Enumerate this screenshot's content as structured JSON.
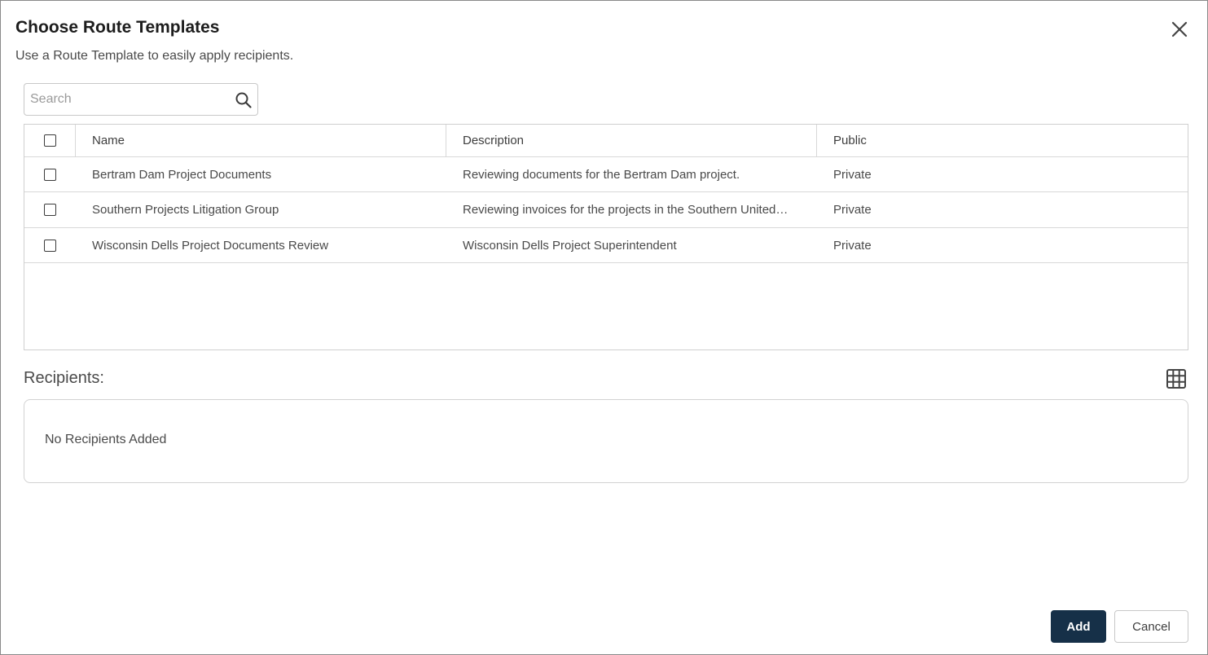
{
  "dialog": {
    "title": "Choose Route Templates",
    "subtitle": "Use a Route Template to easily apply recipients.",
    "close_icon": "close-icon"
  },
  "search": {
    "placeholder": "Search",
    "value": "",
    "icon": "search-icon"
  },
  "table": {
    "columns": [
      "Name",
      "Description",
      "Public"
    ],
    "rows": [
      {
        "name": "Bertram Dam Project Documents",
        "description": "Reviewing documents for the Bertram Dam project.",
        "public": "Private",
        "checked": false
      },
      {
        "name": "Southern Projects Litigation Group",
        "description": "Reviewing invoices for the projects in the Southern United…",
        "public": "Private",
        "checked": false
      },
      {
        "name": "Wisconsin Dells Project Documents Review",
        "description": "Wisconsin Dells Project Superintendent",
        "public": "Private",
        "checked": false
      }
    ]
  },
  "recipients": {
    "label": "Recipients:",
    "empty_text": "No Recipients Added",
    "grid_icon": "grid-icon"
  },
  "footer": {
    "add_label": "Add",
    "cancel_label": "Cancel"
  },
  "colors": {
    "primary_button": "#163048",
    "border": "#cfcfcf",
    "text": "#4a4a4a"
  }
}
